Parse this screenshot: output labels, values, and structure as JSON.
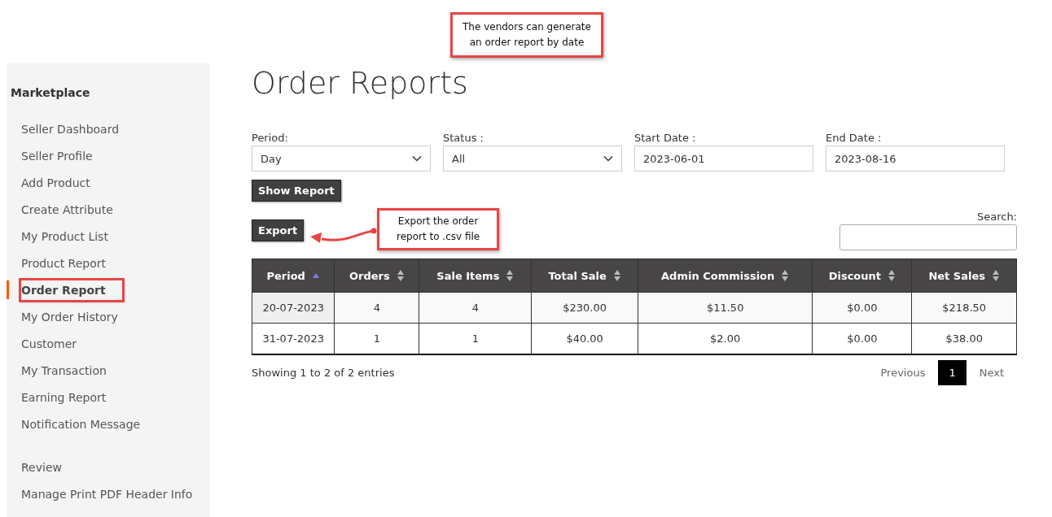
{
  "callouts": [
    {
      "text": "The vendors can generate an order report by date"
    },
    {
      "text": "Export the order report to .csv file"
    }
  ],
  "sidebar": {
    "title": "Marketplace",
    "groups": [
      {
        "items": [
          {
            "label": "Seller Dashboard",
            "selected": false,
            "highlighted": false
          },
          {
            "label": "Seller Profile",
            "selected": false,
            "highlighted": false
          },
          {
            "label": "Add Product",
            "selected": false,
            "highlighted": false
          },
          {
            "label": "Create Attribute",
            "selected": false,
            "highlighted": false
          },
          {
            "label": "My Product List",
            "selected": false,
            "highlighted": false
          },
          {
            "label": "Product Report",
            "selected": false,
            "highlighted": false
          },
          {
            "label": "Order Report",
            "selected": true,
            "highlighted": true
          },
          {
            "label": "My Order History",
            "selected": false,
            "highlighted": false
          },
          {
            "label": "Customer",
            "selected": false,
            "highlighted": false
          },
          {
            "label": "My Transaction",
            "selected": false,
            "highlighted": false
          },
          {
            "label": "Earning Report",
            "selected": false,
            "highlighted": false
          },
          {
            "label": "Notification Message",
            "selected": false,
            "highlighted": false
          }
        ]
      },
      {
        "items": [
          {
            "label": "Review",
            "selected": false,
            "highlighted": false
          },
          {
            "label": "Manage Print PDF Header Info",
            "selected": false,
            "highlighted": false
          }
        ]
      }
    ]
  },
  "page_title": "Order Reports",
  "filters": [
    {
      "kind": "select",
      "label": "Period:",
      "value": "Day"
    },
    {
      "kind": "select",
      "label": "Status :",
      "value": "All"
    },
    {
      "kind": "text",
      "label": "Start Date :",
      "value": "2023-06-01"
    },
    {
      "kind": "text",
      "label": "End Date :",
      "value": "2023-08-16"
    }
  ],
  "show_report_button": "Show Report",
  "export_button": "Export",
  "search": {
    "label": "Search:"
  },
  "table": {
    "columns": [
      {
        "label": "Period",
        "sorted": true
      },
      {
        "label": "Orders",
        "sorted": false
      },
      {
        "label": "Sale Items",
        "sorted": false
      },
      {
        "label": "Total Sale",
        "sorted": false
      },
      {
        "label": "Admin Commission",
        "sorted": false
      },
      {
        "label": "Discount",
        "sorted": false
      },
      {
        "label": "Net Sales",
        "sorted": false
      }
    ],
    "rows": [
      [
        "20-07-2023",
        "4",
        "4",
        "$230.00",
        "$11.50",
        "$0.00",
        "$218.50"
      ],
      [
        "31-07-2023",
        "1",
        "1",
        "$40.00",
        "$2.00",
        "$0.00",
        "$38.00"
      ]
    ]
  },
  "info": "Showing 1 to 2 of 2 entries",
  "pagination": {
    "previous": "Previous",
    "pages": [
      {
        "label": "1",
        "selected": true
      }
    ],
    "next": "Next"
  }
}
